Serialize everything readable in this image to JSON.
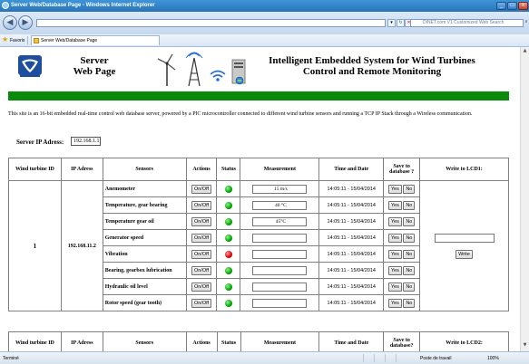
{
  "window": {
    "title": "Server Web/Database Page - Windows Internet Explorer",
    "controls": [
      "_",
      "□",
      "x"
    ]
  },
  "address": {
    "url": "",
    "search_placeholder": "DINET.com V1 Customized Web Search"
  },
  "favorites": {
    "label": "Favoris",
    "tab": "Server Web/Database Page"
  },
  "status": {
    "left": "Terminé",
    "zone": "Poste de travail",
    "zoom": "100%"
  },
  "header": {
    "server_title": "Server\nWeb Page",
    "main_title": "Intelligent Embedded System for Wind Turbines\nControl and Remote Monitoring"
  },
  "description": "This site is an 16-bit embedded real-time control web database server, powered by a PIC microcontroller connected to different wind turbine sensors and running a TCP IP Stack through a Wireless communication.",
  "server_ip": {
    "label": "Server IP Adress:",
    "value": "192.168.1.1"
  },
  "table1": {
    "headers": [
      "Wind turbine ID",
      "IP Adress",
      "Sensors",
      "Actions",
      "Status",
      "Measurement",
      "Time and Date",
      "Save to\ndatabase ?",
      "Write to LCD1:"
    ],
    "turbine_id": "1",
    "ip": "192.168.11.2",
    "action_label": "On/Off",
    "yes_label": "Yes",
    "no_label": "No",
    "write_label": "Write",
    "rows": [
      {
        "sensor": "Anemometer",
        "status": "green",
        "measurement": "15 m/s",
        "datetime": "14:05:11 - 15/04/2014"
      },
      {
        "sensor": "Temperature, gear bearing",
        "status": "green",
        "measurement": "40 °C",
        "datetime": "14:05:11 - 15/04/2014"
      },
      {
        "sensor": "Temperature gear oil",
        "status": "green",
        "measurement": "45°C",
        "datetime": "14:05:11 - 15/04/2014"
      },
      {
        "sensor": "Generator speed",
        "status": "green",
        "measurement": "",
        "datetime": "14:05:11 - 15/04/2014"
      },
      {
        "sensor": "Vibration",
        "status": "red",
        "measurement": "",
        "datetime": "14:05:11 - 15/04/2014"
      },
      {
        "sensor": "Bearing, gearbox lubrication",
        "status": "green",
        "measurement": "",
        "datetime": "14:05:11 - 15/04/2014"
      },
      {
        "sensor": "Hydraulic oil level",
        "status": "green",
        "measurement": "",
        "datetime": "14:05:11 - 15/04/2014"
      },
      {
        "sensor": "Rotor speed (gear tooth)",
        "status": "green",
        "measurement": "",
        "datetime": "14:05:11 - 15/04/2014"
      }
    ]
  },
  "table2": {
    "headers": [
      "Wind turbine ID",
      "IP Adress",
      "Sensors",
      "Actions",
      "Status",
      "Measurement",
      "Time and Date",
      "Save to\ndatabase?",
      "Write to LCD2:"
    ]
  },
  "colors": {
    "banner_green": "#0a8a0a",
    "status_ok": "#00a600",
    "status_alarm": "#e00000",
    "titlebar": "#2a73b8"
  }
}
